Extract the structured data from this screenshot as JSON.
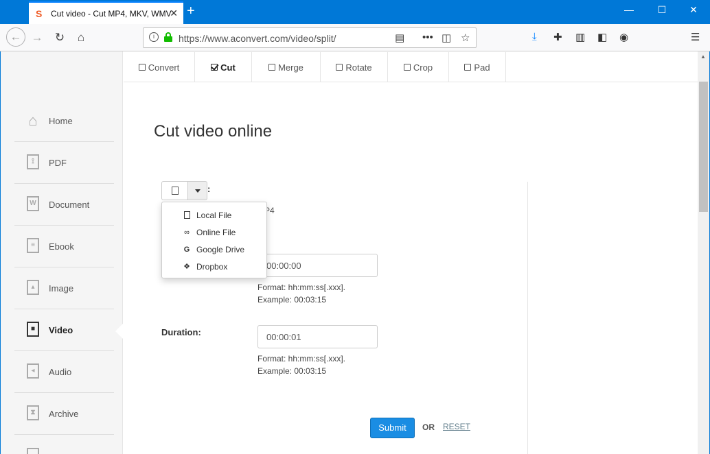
{
  "browser": {
    "tab_title": "Cut video - Cut MP4, MKV, WMV",
    "url_scheme": "https://",
    "url_host": "www.aconvert.com",
    "url_path": "/video/split/"
  },
  "tool_tabs": [
    {
      "label": "Convert",
      "active": false
    },
    {
      "label": "Cut",
      "active": true
    },
    {
      "label": "Merge",
      "active": false
    },
    {
      "label": "Rotate",
      "active": false
    },
    {
      "label": "Crop",
      "active": false
    },
    {
      "label": "Pad",
      "active": false
    }
  ],
  "sidebar": {
    "items": [
      {
        "label": "Home",
        "icon": "home-icon"
      },
      {
        "label": "PDF",
        "icon": "pdf-icon"
      },
      {
        "label": "Document",
        "icon": "document-icon"
      },
      {
        "label": "Ebook",
        "icon": "ebook-icon"
      },
      {
        "label": "Image",
        "icon": "image-icon"
      },
      {
        "label": "Video",
        "icon": "video-icon",
        "active": true
      },
      {
        "label": "Audio",
        "icon": "audio-icon"
      },
      {
        "label": "Archive",
        "icon": "archive-icon"
      }
    ]
  },
  "main": {
    "title": "Cut video online",
    "file_hint": "P4",
    "file_menu": [
      {
        "label": "Local File",
        "icon": "file-icon"
      },
      {
        "label": "Online File",
        "icon": "link-icon"
      },
      {
        "label": "Google Drive",
        "icon": "google-drive-icon"
      },
      {
        "label": "Dropbox",
        "icon": "dropbox-icon"
      }
    ],
    "start": {
      "value": "00:00:00",
      "format": "Format: hh:mm:ss[.xxx].",
      "example": "Example: 00:03:15"
    },
    "duration": {
      "label": "Duration:",
      "value": "00:00:01",
      "format": "Format: hh:mm:ss[.xxx].",
      "example": "Example: 00:03:15"
    },
    "submit_label": "Submit",
    "or_label": "OR",
    "reset_label": "RESET"
  },
  "colors": {
    "titlebar": "#0078d7",
    "submit": "#1a8de3",
    "lock_green": "#12bc00"
  }
}
